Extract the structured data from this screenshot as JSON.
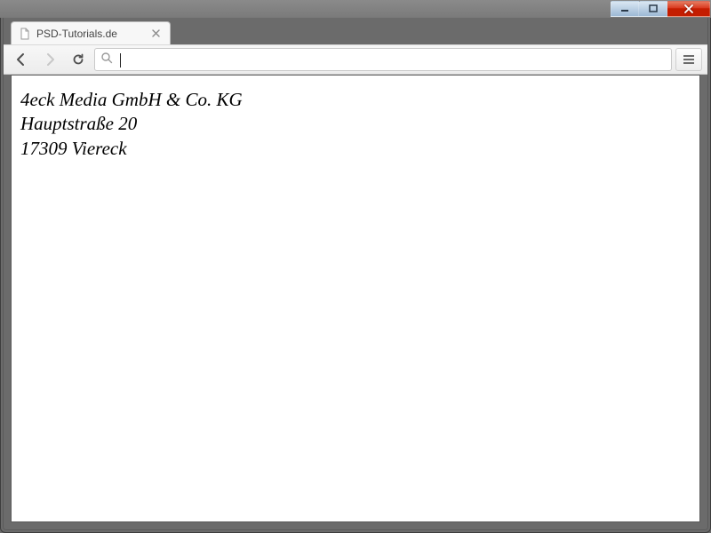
{
  "tab": {
    "title": "PSD-Tutorials.de"
  },
  "omnibox": {
    "value": "",
    "placeholder": ""
  },
  "page": {
    "company": "4eck Media GmbH & Co. KG",
    "street": "Hauptstraße 20",
    "city": "17309 Viereck"
  }
}
